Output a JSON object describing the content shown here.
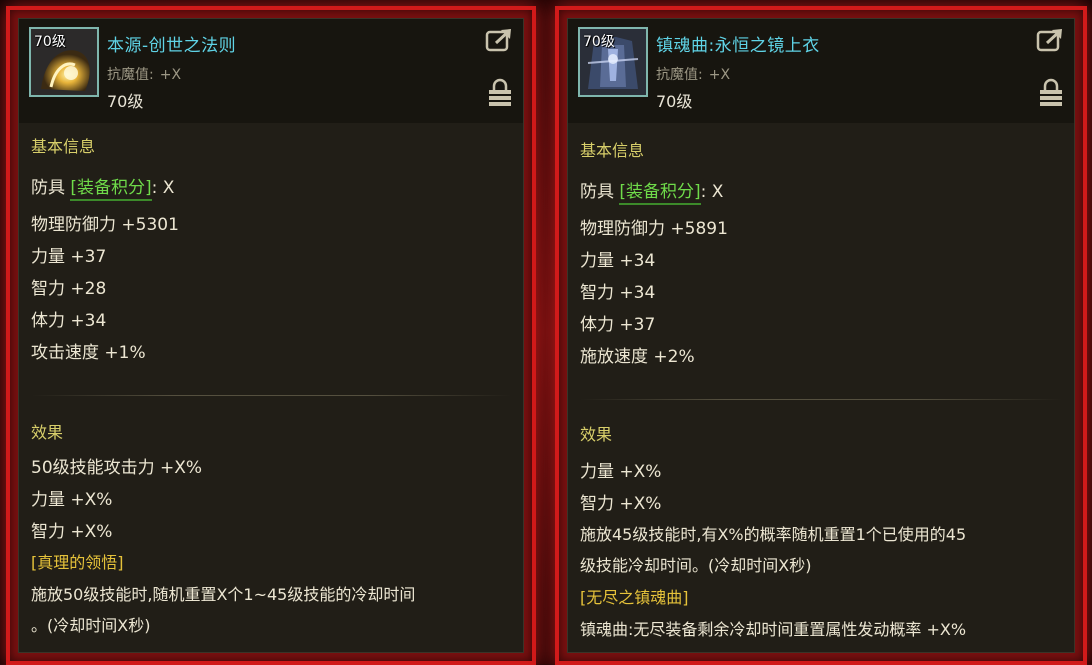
{
  "cards": [
    {
      "level_tag": "70级",
      "name": "本源-创世之法则",
      "resist_label": "抗魔值:",
      "resist_value": "+X",
      "level": "70级",
      "basic_info_title": "基本信息",
      "armor_label": "防具",
      "score_label": "[装备积分]",
      "score_value": ": X",
      "stats": [
        "物理防御力 +5301",
        "力量 +37",
        "智力 +28",
        "体力 +34",
        "攻击速度 +1%"
      ],
      "effect_title": "效果",
      "effects": [
        "50级技能攻击力 +X%",
        "力量 +X%",
        "智力 +X%"
      ],
      "special_title": "[真理的领悟]",
      "special_lines": [
        "施放50级技能时,随机重置X个1~45级技能的冷却时间",
        "。(冷却时间X秒)"
      ]
    },
    {
      "level_tag": "70级",
      "name": "镇魂曲:永恒之镜上衣",
      "resist_label": "抗魔值:",
      "resist_value": "+X",
      "level": "70级",
      "basic_info_title": "基本信息",
      "armor_label": "防具",
      "score_label": "[装备积分]",
      "score_value": ": X",
      "stats": [
        "物理防御力 +5891",
        "力量 +34",
        "智力 +34",
        "体力 +37",
        "施放速度 +2%"
      ],
      "effect_title": "效果",
      "effects": [
        "力量 +X%",
        "智力 +X%",
        "施放45级技能时,有X%的概率随机重置1个已使用的45",
        "级技能冷却时间。(冷却时间X秒)"
      ],
      "special_title": "[无尽之镇魂曲]",
      "special_lines": [
        "镇魂曲:无尽装备剩余冷却时间重置属性发动概率 +X%"
      ]
    }
  ],
  "colors": {
    "frame": "#d11a1a",
    "item_name": "#5fd3e6",
    "section_title": "#d8cf6a",
    "score_label": "#6fdb4a",
    "special_title": "#e5c23a"
  }
}
